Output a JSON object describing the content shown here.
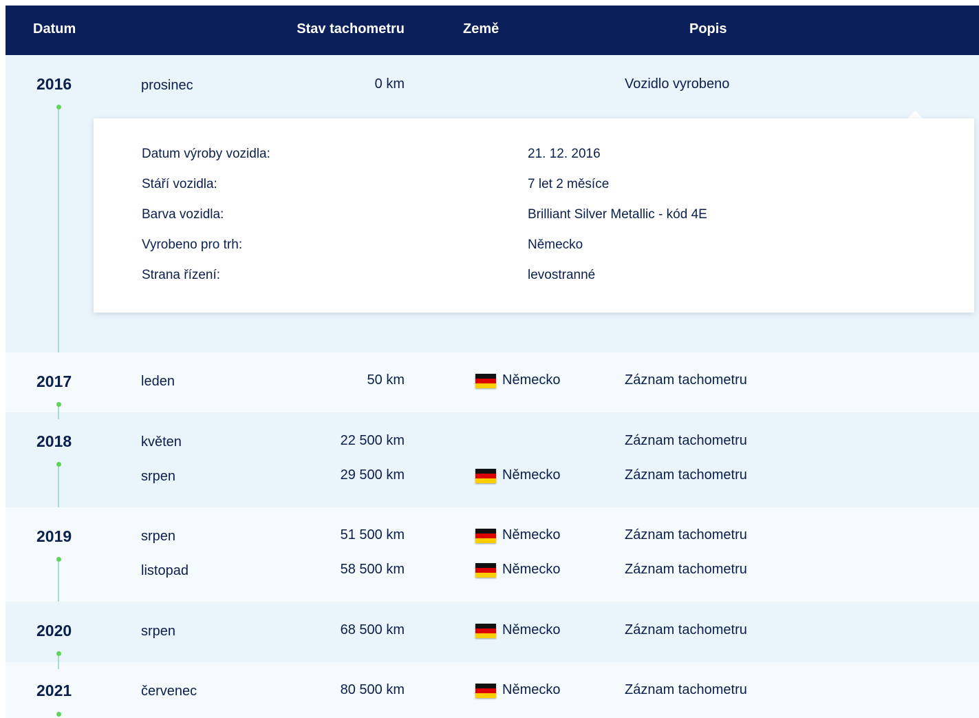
{
  "header": {
    "date": "Datum",
    "odometer": "Stav tachometru",
    "country": "Země",
    "description": "Popis"
  },
  "colors": {
    "header_bg": "#0b1f5a",
    "row_bg_a": "#eaf4fb",
    "row_bg_b": "#f5fafd",
    "dot": "#5fd35b",
    "line": "#a9dccd",
    "text": "#0b1f4d"
  },
  "years": [
    {
      "year": "2016",
      "records": [
        {
          "month": "prosinec",
          "odometer": "0 km",
          "country": "",
          "description": "Vozidlo vyrobeno"
        }
      ]
    },
    {
      "year": "2017",
      "records": [
        {
          "month": "leden",
          "odometer": "50 km",
          "country": "Německo",
          "description": "Záznam tachometru"
        }
      ]
    },
    {
      "year": "2018",
      "records": [
        {
          "month": "květen",
          "odometer": "22 500 km",
          "country": "",
          "description": "Záznam tachometru"
        },
        {
          "month": "srpen",
          "odometer": "29 500 km",
          "country": "Německo",
          "description": "Záznam tachometru"
        }
      ]
    },
    {
      "year": "2019",
      "records": [
        {
          "month": "srpen",
          "odometer": "51 500 km",
          "country": "Německo",
          "description": "Záznam tachometru"
        },
        {
          "month": "listopad",
          "odometer": "58 500 km",
          "country": "Německo",
          "description": "Záznam tachometru"
        }
      ]
    },
    {
      "year": "2020",
      "records": [
        {
          "month": "srpen",
          "odometer": "68 500 km",
          "country": "Německo",
          "description": "Záznam tachometru"
        }
      ]
    },
    {
      "year": "2021",
      "records": [
        {
          "month": "červenec",
          "odometer": "80 500 km",
          "country": "Německo",
          "description": "Záznam tachometru"
        }
      ]
    }
  ],
  "details": [
    {
      "label": "Datum výroby vozidla:",
      "value": "21. 12. 2016"
    },
    {
      "label": "Stáří vozidla:",
      "value": "7 let 2 měsíce"
    },
    {
      "label": "Barva vozidla:",
      "value": "Brilliant Silver Metallic - kód 4E"
    },
    {
      "label": "Vyrobeno pro trh:",
      "value": "Německo"
    },
    {
      "label": "Strana řízení:",
      "value": "levostranné"
    }
  ],
  "icons": {
    "flag": "germany-flag-icon"
  }
}
